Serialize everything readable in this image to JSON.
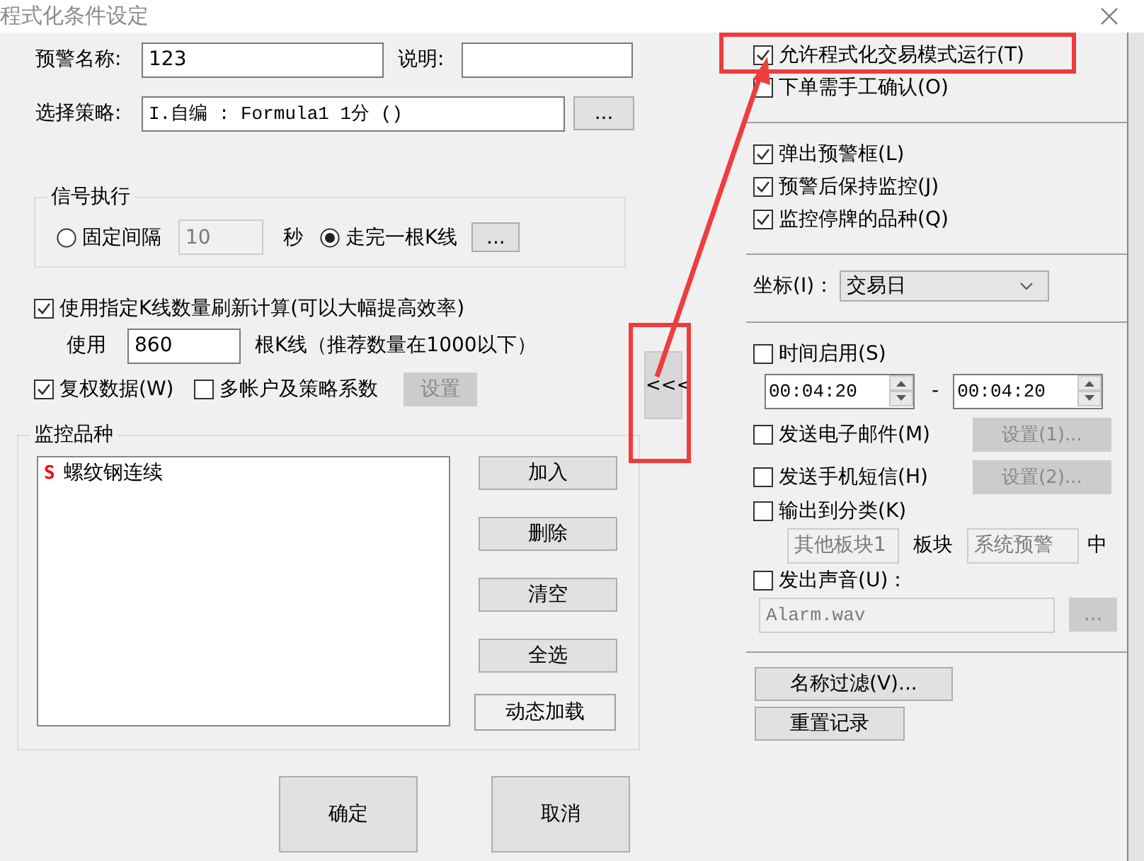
{
  "window": {
    "title": "程式化条件设定"
  },
  "form": {
    "name_label": "预警名称:",
    "name_value": "123",
    "desc_label": "说明:",
    "strategy_label": "选择策略:",
    "strategy_value": "I.自编 : Formula1 1分 ()",
    "strategy_button": "..."
  },
  "signal": {
    "title": "信号执行",
    "options": [
      {
        "label": "固定间隔",
        "selected": false
      },
      {
        "label": "走完一根K线",
        "selected": true
      }
    ],
    "interval_value": "10",
    "interval_unit": "秒",
    "button": "..."
  },
  "refresh": {
    "label": "使用指定K线数量刷新计算(可以大幅提高效率)",
    "checked": true,
    "use_label": "使用",
    "bars_value": "860",
    "bars_hint": "根K线（推荐数量在1000以下）"
  },
  "restore": {
    "label": "复权数据(W)",
    "checked": true
  },
  "multi_account": {
    "label": "多帐户及策略系数",
    "checked": false
  },
  "settings_button": {
    "label": "设置",
    "disabled": true
  },
  "monitor": {
    "title": "监控品种",
    "items": [
      {
        "marker": "S",
        "name": "螺纹钢连续"
      }
    ],
    "buttons": [
      {
        "label": "加入",
        "kind": "plain"
      },
      {
        "label": "删除",
        "kind": "plain"
      },
      {
        "label": "清空",
        "kind": "plain"
      },
      {
        "label": "全选",
        "kind": "plain"
      },
      {
        "label": "动态加载",
        "kind": "raised"
      }
    ]
  },
  "dialog_buttons": [
    "确定",
    "取消"
  ],
  "collapse_button": {
    "label": "<<<",
    "highlighted": true
  },
  "right": {
    "items": [
      {
        "kind": "check",
        "label": "允许程式化交易模式运行(T)",
        "checked": true,
        "highlighted": true
      },
      {
        "kind": "check",
        "label": "下单需手工确认(O)",
        "checked": false
      },
      {
        "kind": "separator"
      },
      {
        "kind": "check",
        "label": "弹出预警框(L)",
        "checked": true
      },
      {
        "kind": "check",
        "label": "预警后保持监控(J)",
        "checked": true
      },
      {
        "kind": "check",
        "label": "监控停牌的品种(Q)",
        "checked": true
      },
      {
        "kind": "separator"
      },
      {
        "kind": "select",
        "label": "坐标(I)：",
        "value": "交易日"
      },
      {
        "kind": "separator"
      },
      {
        "kind": "check",
        "label": "时间启用(S)",
        "checked": false
      },
      {
        "kind": "time_range",
        "start": "00:04:20",
        "dash": "-",
        "end": "00:04:20"
      },
      {
        "kind": "check_button",
        "label": "发送电子邮件(M)",
        "checked": false,
        "button": "设置(1)...",
        "button_disabled": true
      },
      {
        "kind": "check_button",
        "label": "发送手机短信(H)",
        "checked": false,
        "button": "设置(2)...",
        "button_disabled": true
      },
      {
        "kind": "check",
        "label": "输出到分类(K)",
        "checked": false
      },
      {
        "kind": "category",
        "value": "其他板块1",
        "mid_label": "板块",
        "target": "系统预警",
        "end_label": "中"
      },
      {
        "kind": "check",
        "label": "发出声音(U)：",
        "checked": false
      },
      {
        "kind": "file",
        "value": "Alarm.wav",
        "button": "...",
        "button_disabled": true
      },
      {
        "kind": "separator"
      },
      {
        "kind": "button",
        "label": "名称过滤(V)..."
      },
      {
        "kind": "button",
        "label": "重置记录"
      }
    ]
  }
}
